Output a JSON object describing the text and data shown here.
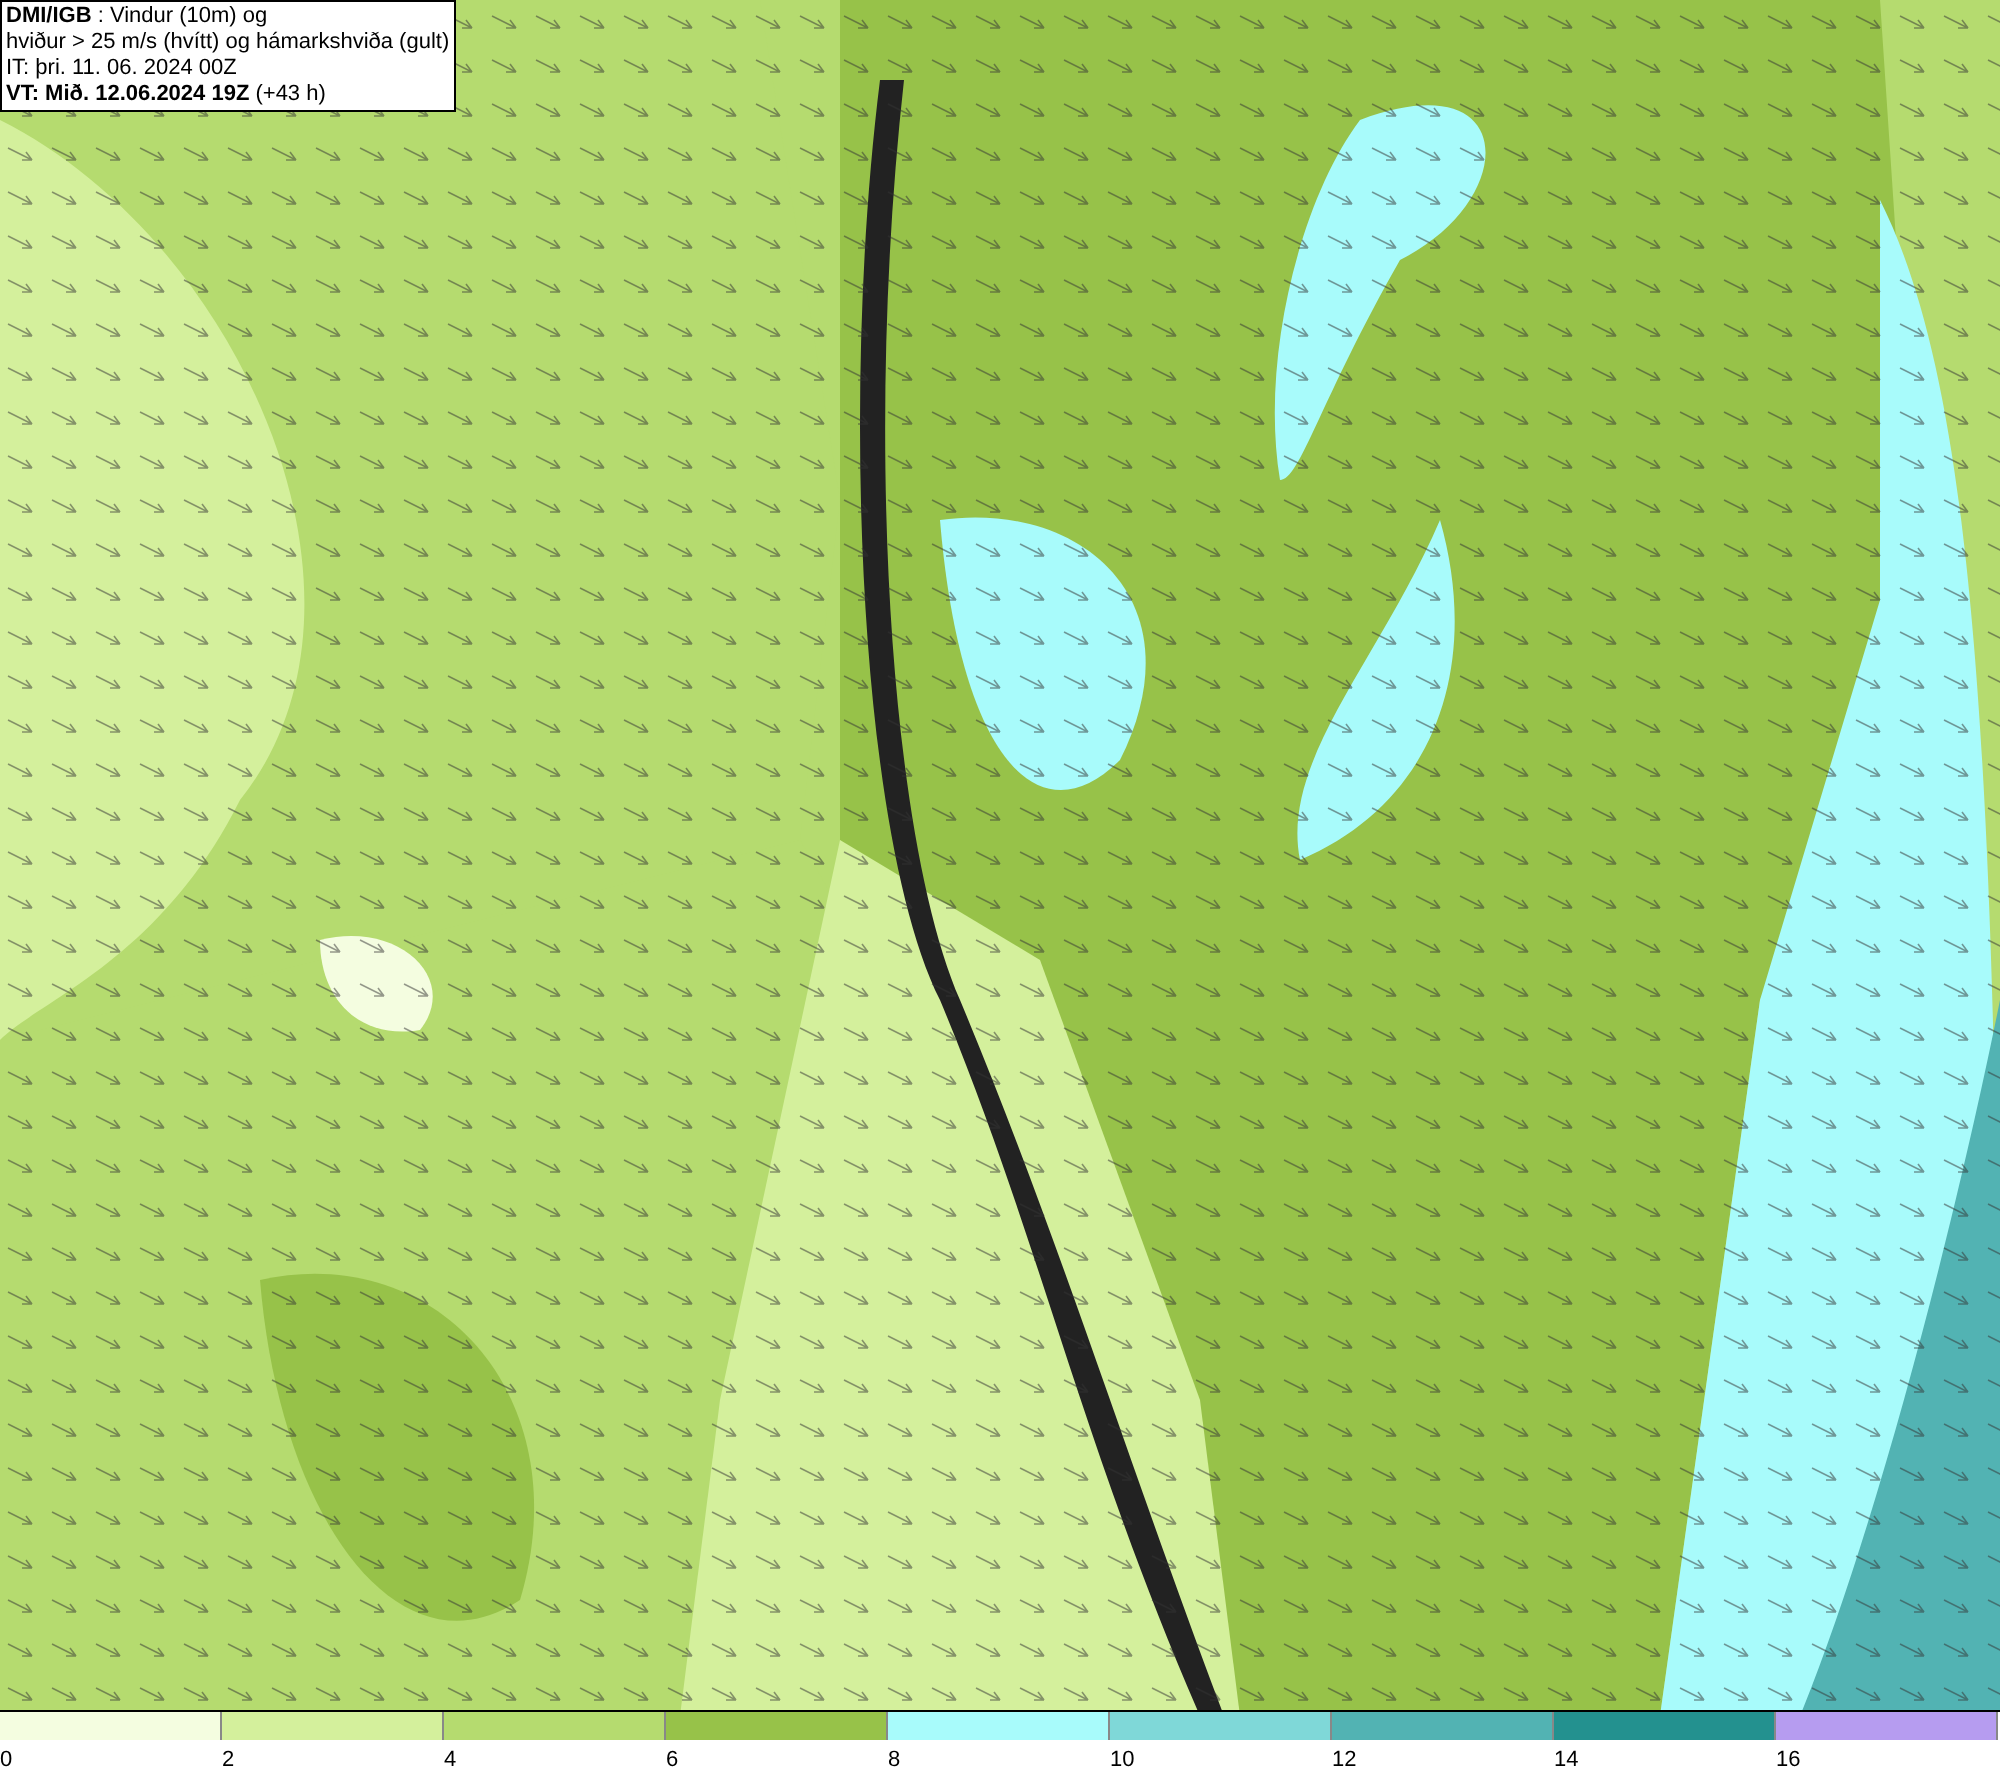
{
  "header": {
    "lines": [
      "**DMI/IGB** : Vindur (10m) og",
      "hviður > 25 m/s (hvítt) og hámarkshviða (gult)",
      "IT: þri. 11. 06. 2024 00Z",
      "**VT: Mið. 12.06.2024 19Z** (+43 h)"
    ]
  },
  "legend": {
    "bins": [
      {
        "color": "#f4fde0"
      },
      {
        "color": "#d4f09c"
      },
      {
        "color": "#b5db6f"
      },
      {
        "color": "#97c249"
      },
      {
        "color": "#a8fbfb"
      },
      {
        "color": "#7fd8d8"
      },
      {
        "color": "#52b3b3"
      },
      {
        "color": "#23918f"
      },
      {
        "color": "#b69cf0"
      }
    ],
    "labels": [
      "0",
      "2",
      "4",
      "6",
      "8",
      "10",
      "12",
      "14",
      "16"
    ]
  }
}
